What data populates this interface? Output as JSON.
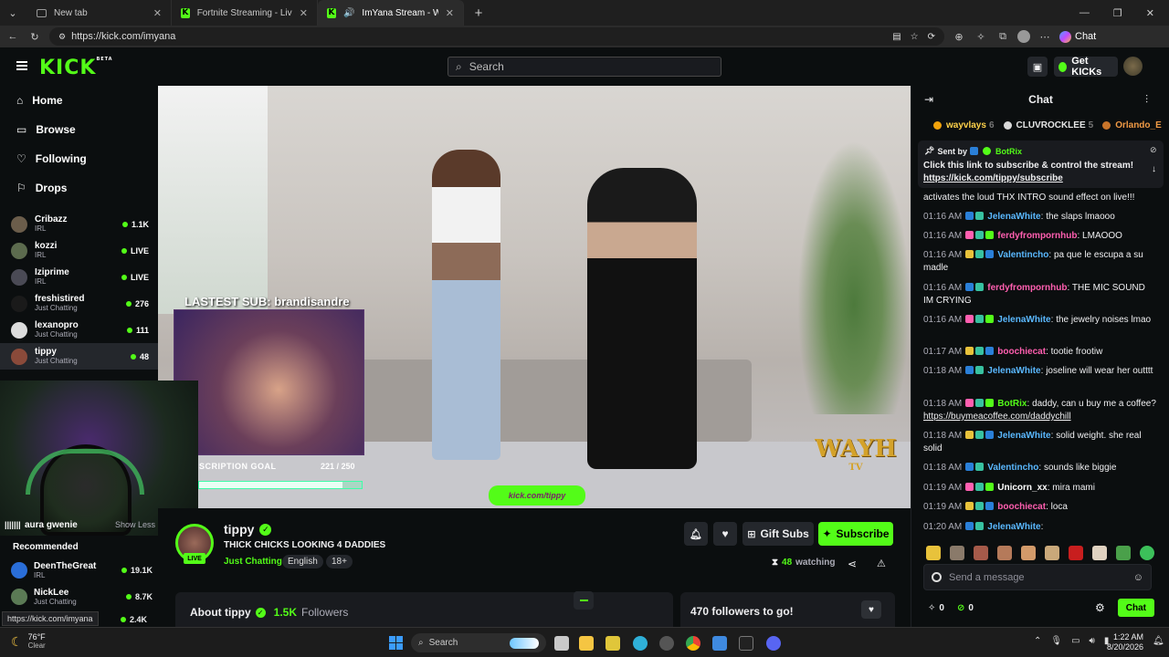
{
  "browser": {
    "tabs": [
      {
        "title": "New tab"
      },
      {
        "title": "Fortnite Streaming - Live Streams"
      },
      {
        "title": "ImYana Stream - Watch Live o"
      }
    ],
    "url": "https://kick.com/imyana",
    "chat_label": "Chat"
  },
  "header": {
    "logo": "KICK",
    "logo_badge": "BETA",
    "search_placeholder": "Search",
    "get_kicks": "Get KICKs"
  },
  "sidebar": {
    "nav": [
      {
        "label": "Home",
        "icon": "home-icon"
      },
      {
        "label": "Browse",
        "icon": "browse-icon"
      },
      {
        "label": "Following",
        "icon": "heart-icon"
      },
      {
        "label": "Drops",
        "icon": "drops-icon"
      }
    ],
    "channels": [
      {
        "name": "Cribazz",
        "category": "IRL",
        "viewers": "1.1K"
      },
      {
        "name": "kozzi",
        "category": "IRL",
        "viewers": "LIVE"
      },
      {
        "name": "Iziprime",
        "category": "IRL",
        "viewers": "LIVE"
      },
      {
        "name": "freshistired",
        "category": "Just Chatting",
        "viewers": "276"
      },
      {
        "name": "lexanopro",
        "category": "Just Chatting",
        "viewers": "111"
      },
      {
        "name": "tippy",
        "category": "Just Chatting",
        "viewers": "48"
      }
    ],
    "lower": {
      "partial_name": "aura gwenie",
      "show_less": "Show Less",
      "recommended_heading": "Recommended",
      "recommended": [
        {
          "name": "DeenTheGreat",
          "category": "IRL",
          "viewers": "19.1K"
        },
        {
          "name": "NickLee",
          "category": "Just Chatting",
          "viewers": "8.7K"
        },
        {
          "name": "",
          "category": "",
          "viewers": "2.4K"
        }
      ]
    }
  },
  "video": {
    "latest_sub": "LASTEST SUB: brandisandre",
    "sub_goal_label": "SCRIPTION GOAL",
    "sub_goal_value": "221 / 250",
    "sub_goal_progress": 0.884,
    "watermark": "WAYH",
    "watermark_sub": "TV",
    "kick_tag": "kick.com/tippy"
  },
  "stream": {
    "streamer": "tippy",
    "live_badge": "LIVE",
    "title": "THICK CHICKS LOOKING 4 DADDIES",
    "category": "Just Chatting",
    "tags": [
      "English",
      "18+"
    ],
    "watching_count": "48",
    "watching_label": "watching",
    "gift_subs": "Gift Subs",
    "subscribe": "Subscribe",
    "about_label": "About tippy",
    "followers_count": "1.5K",
    "followers_label": "Followers",
    "followers_to_go": "470 followers to go!"
  },
  "chat": {
    "title": "Chat",
    "top_gifters": [
      {
        "name": "wayvlays",
        "count": "6"
      },
      {
        "name": "CLUVROCKLEE",
        "count": "5"
      },
      {
        "name": "Orlando_E",
        "count": ""
      }
    ],
    "pinned": {
      "sent_by": "Sent by",
      "sender": "BotRix",
      "text": "Click this link to subscribe & control the stream!",
      "link": "https://kick.com/tippy/subscribe"
    },
    "first_line": "activates the loud THX INTRO sound effect on live!!!",
    "messages": [
      {
        "time": "01:16 AM",
        "user": "JelenaWhite",
        "color": "#5ab8ff",
        "text": "the slaps lmaooo"
      },
      {
        "time": "01:16 AM",
        "user": "ferdyfrompornhub",
        "color": "#ff5fb0",
        "text": "LMAOOO"
      },
      {
        "time": "01:16 AM",
        "user": "Valentincho",
        "color": "#5ab8ff",
        "text": "pa que le escupa a su madle"
      },
      {
        "time": "01:16 AM",
        "user": "ferdyfrompornhub",
        "color": "#ff5fb0",
        "text": "THE MIC SOUND IM CRYING"
      },
      {
        "time": "01:16 AM",
        "user": "JelenaWhite",
        "color": "#5ab8ff",
        "text": "the jewelry noises lmao"
      },
      {
        "time": "01:17 AM",
        "user": "boochiecat",
        "color": "#ff5fb0",
        "text": "tootie frootiw"
      },
      {
        "time": "01:18 AM",
        "user": "JelenaWhite",
        "color": "#5ab8ff",
        "text": "joseline will wear her outttt"
      },
      {
        "time": "01:18 AM",
        "user": "BotRix",
        "color": "#53fc18",
        "text": "daddy, can u buy me a coffee?",
        "link": "https://buymeacoffee.com/daddychill"
      },
      {
        "time": "01:18 AM",
        "user": "JelenaWhite",
        "color": "#5ab8ff",
        "text": "solid weight. she real solid"
      },
      {
        "time": "01:18 AM",
        "user": "Valentincho",
        "color": "#5ab8ff",
        "text": "sounds like biggie"
      },
      {
        "time": "01:19 AM",
        "user": "Unicorn_xx",
        "color": "#ffffff",
        "text": "mira mami"
      },
      {
        "time": "01:19 AM",
        "user": "boochiecat",
        "color": "#ff5fb0",
        "text": "loca"
      },
      {
        "time": "01:20 AM",
        "user": "JelenaWhite",
        "color": "#5ab8ff",
        "text": ""
      }
    ],
    "input_placeholder": "Send a message",
    "count_a": "0",
    "count_b": "0",
    "send_label": "Chat"
  },
  "status_url": "https://kick.com/imyana",
  "taskbar": {
    "weather_temp": "76°F",
    "weather_desc": "Clear",
    "search": "Search",
    "time": "1:22 AM",
    "date": "8/20/2026"
  },
  "colors": {
    "kick_green": "#53fc18",
    "bg": "#0b0e0f",
    "panel": "#24272c"
  }
}
